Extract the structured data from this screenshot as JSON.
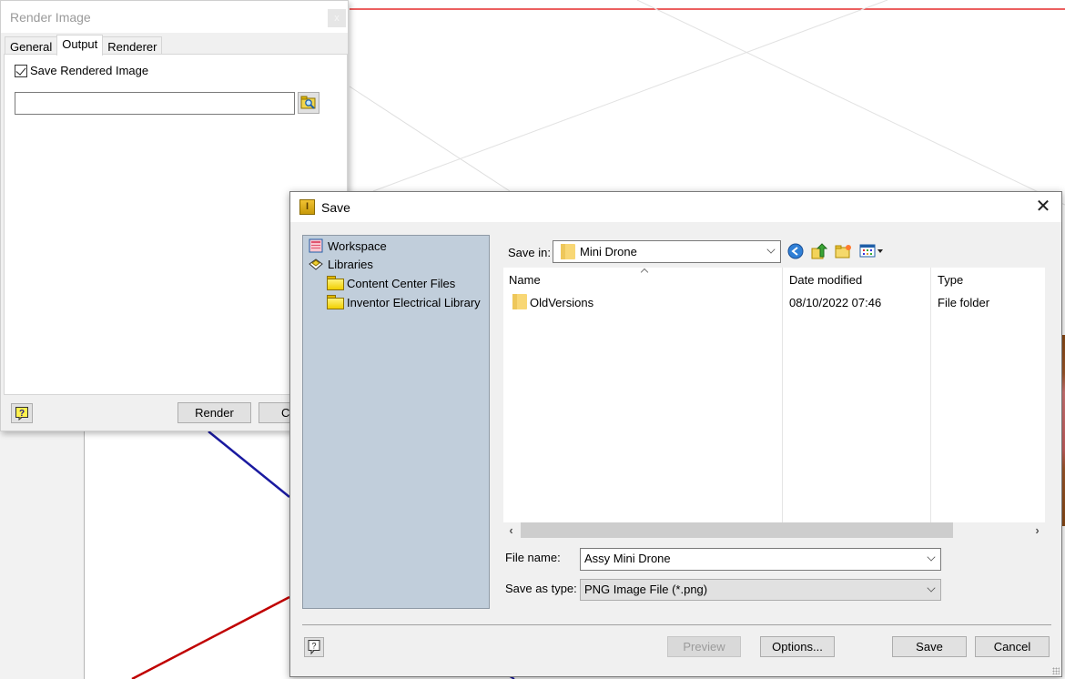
{
  "render_dialog": {
    "title": "Render Image",
    "close_label": "x",
    "tabs": [
      {
        "label": "General",
        "active": false
      },
      {
        "label": "Output",
        "active": true
      },
      {
        "label": "Renderer",
        "active": false
      }
    ],
    "save_rendered_image": {
      "label": "Save Rendered Image",
      "checked": true
    },
    "output_path": {
      "value": "",
      "placeholder": ""
    },
    "buttons": {
      "render": "Render",
      "close_partial": "Cl"
    }
  },
  "save_dialog": {
    "title": "Save",
    "close_label": "✕",
    "places": [
      {
        "label": "Workspace",
        "icon": "workspace-icon",
        "indent": 0
      },
      {
        "label": "Libraries",
        "icon": "libraries-icon",
        "indent": 0
      },
      {
        "label": "Content Center Files",
        "icon": "folder-icon",
        "indent": 1
      },
      {
        "label": "Inventor Electrical Library",
        "icon": "folder-icon",
        "indent": 1
      }
    ],
    "save_in": {
      "label": "Save in:",
      "value": "Mini Drone"
    },
    "toolbar": [
      "back-icon",
      "up-folder-icon",
      "new-folder-icon",
      "view-menu-icon"
    ],
    "columns": [
      "Name",
      "Date modified",
      "Type"
    ],
    "files": [
      {
        "name": "OldVersions",
        "date_modified": "08/10/2022 07:46",
        "type": "File folder"
      }
    ],
    "file_name": {
      "label": "File name:",
      "value": "Assy Mini Drone"
    },
    "save_as_type": {
      "label": "Save as type:",
      "value": "PNG Image File (*.png)"
    },
    "buttons": {
      "preview": "Preview",
      "options": "Options...",
      "save": "Save",
      "cancel": "Cancel"
    }
  },
  "colors": {
    "places_bg": "#c1cedb",
    "axis_red": "#c00000",
    "axis_blue": "#1a1aa0",
    "top_red_line": "#e00000"
  }
}
